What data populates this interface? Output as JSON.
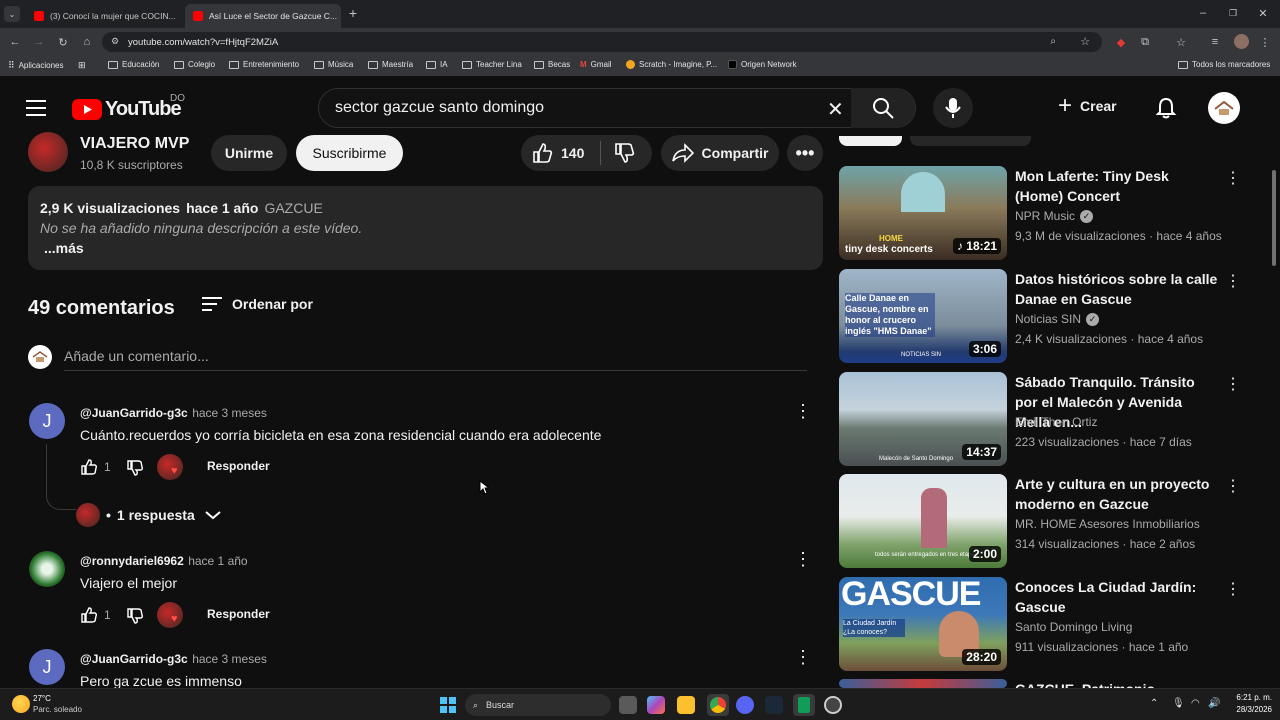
{
  "browser": {
    "tabs": [
      {
        "title": "(3) Conocí la mujer que COCIN..."
      },
      {
        "title": "Así Luce el Sector de Gazcue C..."
      }
    ],
    "url": "youtube.com/watch?v=fHjtqF2MZiA",
    "bookmarks": [
      "Aplicaciones",
      "Educación",
      "Colegio",
      "Entretenimiento",
      "Música",
      "Maestría",
      "IA",
      "Teacher Lina",
      "Becas",
      "Gmail",
      "Scratch - Imagine, P...",
      "Origen Network"
    ],
    "all_bookmarks": "Todos los marcadores"
  },
  "youtube": {
    "logo_text": "YouTube",
    "region": "DO",
    "search_value": "sector gazcue santo domingo",
    "create_label": "Crear"
  },
  "channel": {
    "name": "VIAJERO MVP",
    "subscribers": "10,8 K suscriptores",
    "join_label": "Unirme",
    "subscribe_label": "Suscribirme",
    "likes": "140",
    "share_label": "Compartir"
  },
  "description": {
    "views": "2,9 K visualizaciones",
    "date": "hace 1 año",
    "tag": "GAZCUE",
    "text": "No se ha añadido ninguna descripción a este vídeo.",
    "more": "...más"
  },
  "comments": {
    "count_label": "49 comentarios",
    "sort_label": "Ordenar por",
    "add_placeholder": "Añade un comentario...",
    "reply_label": "Responder",
    "items": [
      {
        "avatar": "J",
        "author": "@JuanGarrido-g3c",
        "time": "hace 3 meses",
        "text": "Cuánto.recuerdos yo corría bicicleta en esa zona residencial cuando era adolecente",
        "likes": "1",
        "replies": "1 respuesta"
      },
      {
        "avatar": "",
        "author": "@ronnydariel6962",
        "time": "hace 1 año",
        "text": "Viajero el mejor",
        "likes": "1"
      },
      {
        "avatar": "J",
        "author": "@JuanGarrido-g3c",
        "time": "hace 3 meses",
        "text": "Pero ga zcue es immenso"
      }
    ]
  },
  "related": [
    {
      "title": "Mon Laferte: Tiny Desk (Home) Concert",
      "channel": "NPR Music",
      "verified": true,
      "meta": "9,3 M de visualizaciones · hace 4 años",
      "duration": "18:21",
      "overlay": "tiny desk concerts",
      "overlay2": "HOME"
    },
    {
      "title": "Datos históricos sobre la calle Danae en Gascue",
      "channel": "Noticias SIN",
      "verified": true,
      "meta": "2,4 K visualizaciones · hace 4 años",
      "duration": "3:06",
      "overlay": "Calle Danae en Gascue, nombre en honor al crucero inglés \"HMS Danae\"",
      "overlay2": "NOTICIAS SIN"
    },
    {
      "title": "Sábado Tranquilo. Tránsito por el Malecón y Avenida Mella en...",
      "channel": "Emil Then Ortiz",
      "verified": false,
      "meta": "223 visualizaciones · hace 7 días",
      "duration": "14:37",
      "overlay": "Malecón de Santo Domingo"
    },
    {
      "title": "Arte y cultura en un proyecto moderno en Gazcue",
      "channel": "MR. HOME Asesores Inmobiliarios",
      "verified": false,
      "meta": "314 visualizaciones · hace 2 años",
      "duration": "2:00",
      "overlay": "todos serán entregados en tres etapas"
    },
    {
      "title": "Conoces La Ciudad Jardín: Gascue",
      "channel": "Santo Domingo Living",
      "verified": false,
      "meta": "911 visualizaciones · hace 1 año",
      "duration": "28:20",
      "overlay": "GASCUE",
      "overlay2": "La Ciudad Jardín ¿La conoces?"
    },
    {
      "title": "GAZCUE, Patrimonio..."
    }
  ],
  "taskbar": {
    "temp": "27°C",
    "weather": "Parc. soleado",
    "search": "Buscar",
    "time": "6:21 p. m.",
    "date": "28/3/2026"
  }
}
